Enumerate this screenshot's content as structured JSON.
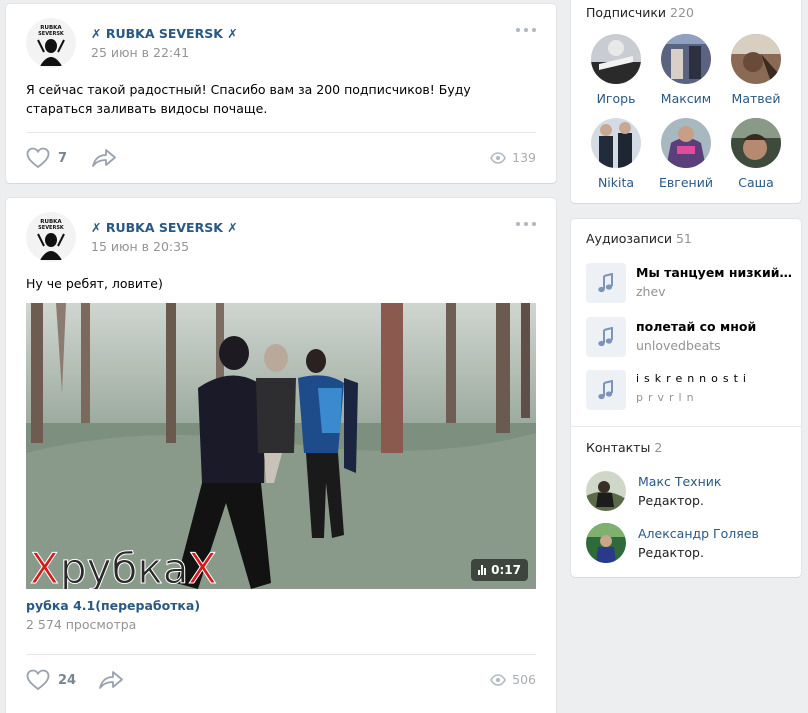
{
  "posts": [
    {
      "author": "✗ RUBKA SEVERSK ✗",
      "avatar_text_top": "RUBKA",
      "avatar_text_bottom": "SEVERSK",
      "date": "25 июн в 22:41",
      "text": "Я сейчас такой радостный! Спасибо вам за 200 подписчиков! Буду стараться заливать видосы почаще.",
      "likes": "7",
      "views": "139"
    },
    {
      "author": "✗ RUBKA SEVERSK ✗",
      "avatar_text_top": "RUBKA",
      "avatar_text_bottom": "SEVERSK",
      "date": "15 июн в 20:35",
      "text": "Ну че ребят, ловите)",
      "video": {
        "watermark_x1": "X",
        "watermark_word": "рубка",
        "watermark_x2": "X",
        "duration": "0:17",
        "title": "рубка 4.1(переработка)",
        "views": "2 574 просмотра"
      },
      "likes": "24",
      "views": "506"
    }
  ],
  "subscribers": {
    "title": "Подписчики",
    "count": "220",
    "people": [
      {
        "name": "Игорь",
        "color": "#c9ccd2"
      },
      {
        "name": "Максим",
        "color": "#5a6480"
      },
      {
        "name": "Матвей",
        "color": "#8a6a55"
      },
      {
        "name": "Nikita",
        "color": "#4b5a6a"
      },
      {
        "name": "Евгений",
        "color": "#5a3f7a"
      },
      {
        "name": "Саша",
        "color": "#6a7a60"
      }
    ]
  },
  "audio": {
    "title": "Аудиозаписи",
    "count": "51",
    "tracks": [
      {
        "name": "Мы танцуем низкий фле...",
        "artist": "zhev"
      },
      {
        "name": "полетай со мной",
        "artist": "unlovedbeats"
      },
      {
        "name": "iskrennosti",
        "artist": "prvrln"
      }
    ]
  },
  "contacts": {
    "title": "Контакты",
    "count": "2",
    "people": [
      {
        "name": "Макс Техник",
        "role": "Редактор.",
        "color": "#5b6b4a"
      },
      {
        "name": "Александр Голяев",
        "role": "Редактор.",
        "color": "#2f6a3a"
      }
    ]
  },
  "colors": {
    "link": "#2a5885",
    "muted": "#939393",
    "background": "#edeef0",
    "watermark_red": "#d41a1a"
  }
}
